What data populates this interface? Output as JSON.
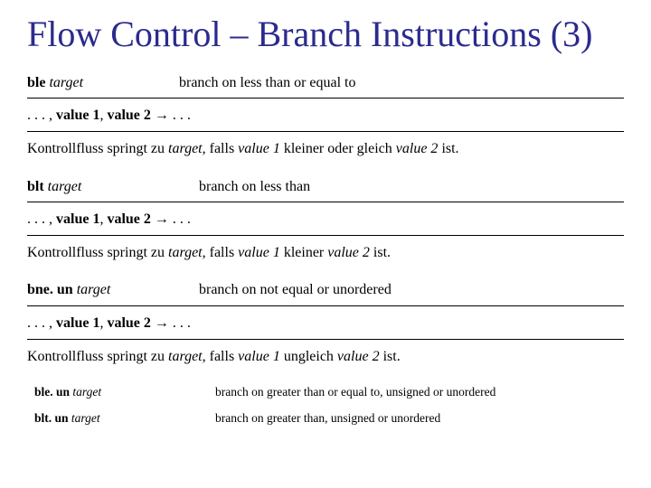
{
  "title": "Flow Control – Branch Instructions (3)",
  "sections": [
    {
      "op_prefix": "ble",
      "op_italic": "target",
      "desc": "branch on less than or equal to",
      "stack_html": ". . . , <b>value 1</b>, <b>value 2</b> → . . .",
      "expl_html": "Kontrollfluss springt zu <i>target</i>, falls <i>value 1</i> kleiner oder gleich <i>value 2</i> ist."
    },
    {
      "op_prefix": "blt",
      "op_italic": "target",
      "desc": "branch on less than",
      "stack_html": ". . . , <b>value 1</b>, <b>value 2</b> → . . .",
      "expl_html": "Kontrollfluss springt zu <i>target</i>, falls <i>value 1</i> kleiner <i>value 2</i> ist."
    },
    {
      "op_prefix": "bne. un",
      "op_italic": "target",
      "desc": "branch on not equal or unordered",
      "stack_html": ". . . , <b>value 1</b>, <b>value 2</b> → . . .",
      "expl_html": "Kontrollfluss springt zu <i>target</i>, falls <i>value 1</i> ungleich <i>value 2</i> ist."
    }
  ],
  "small_rows": [
    {
      "op_prefix": "ble. un",
      "op_italic": "target",
      "desc": "branch on greater than or equal to, unsigned or unordered"
    },
    {
      "op_prefix": "blt. un",
      "op_italic": "target",
      "desc": "branch on greater than, unsigned or unordered"
    }
  ]
}
